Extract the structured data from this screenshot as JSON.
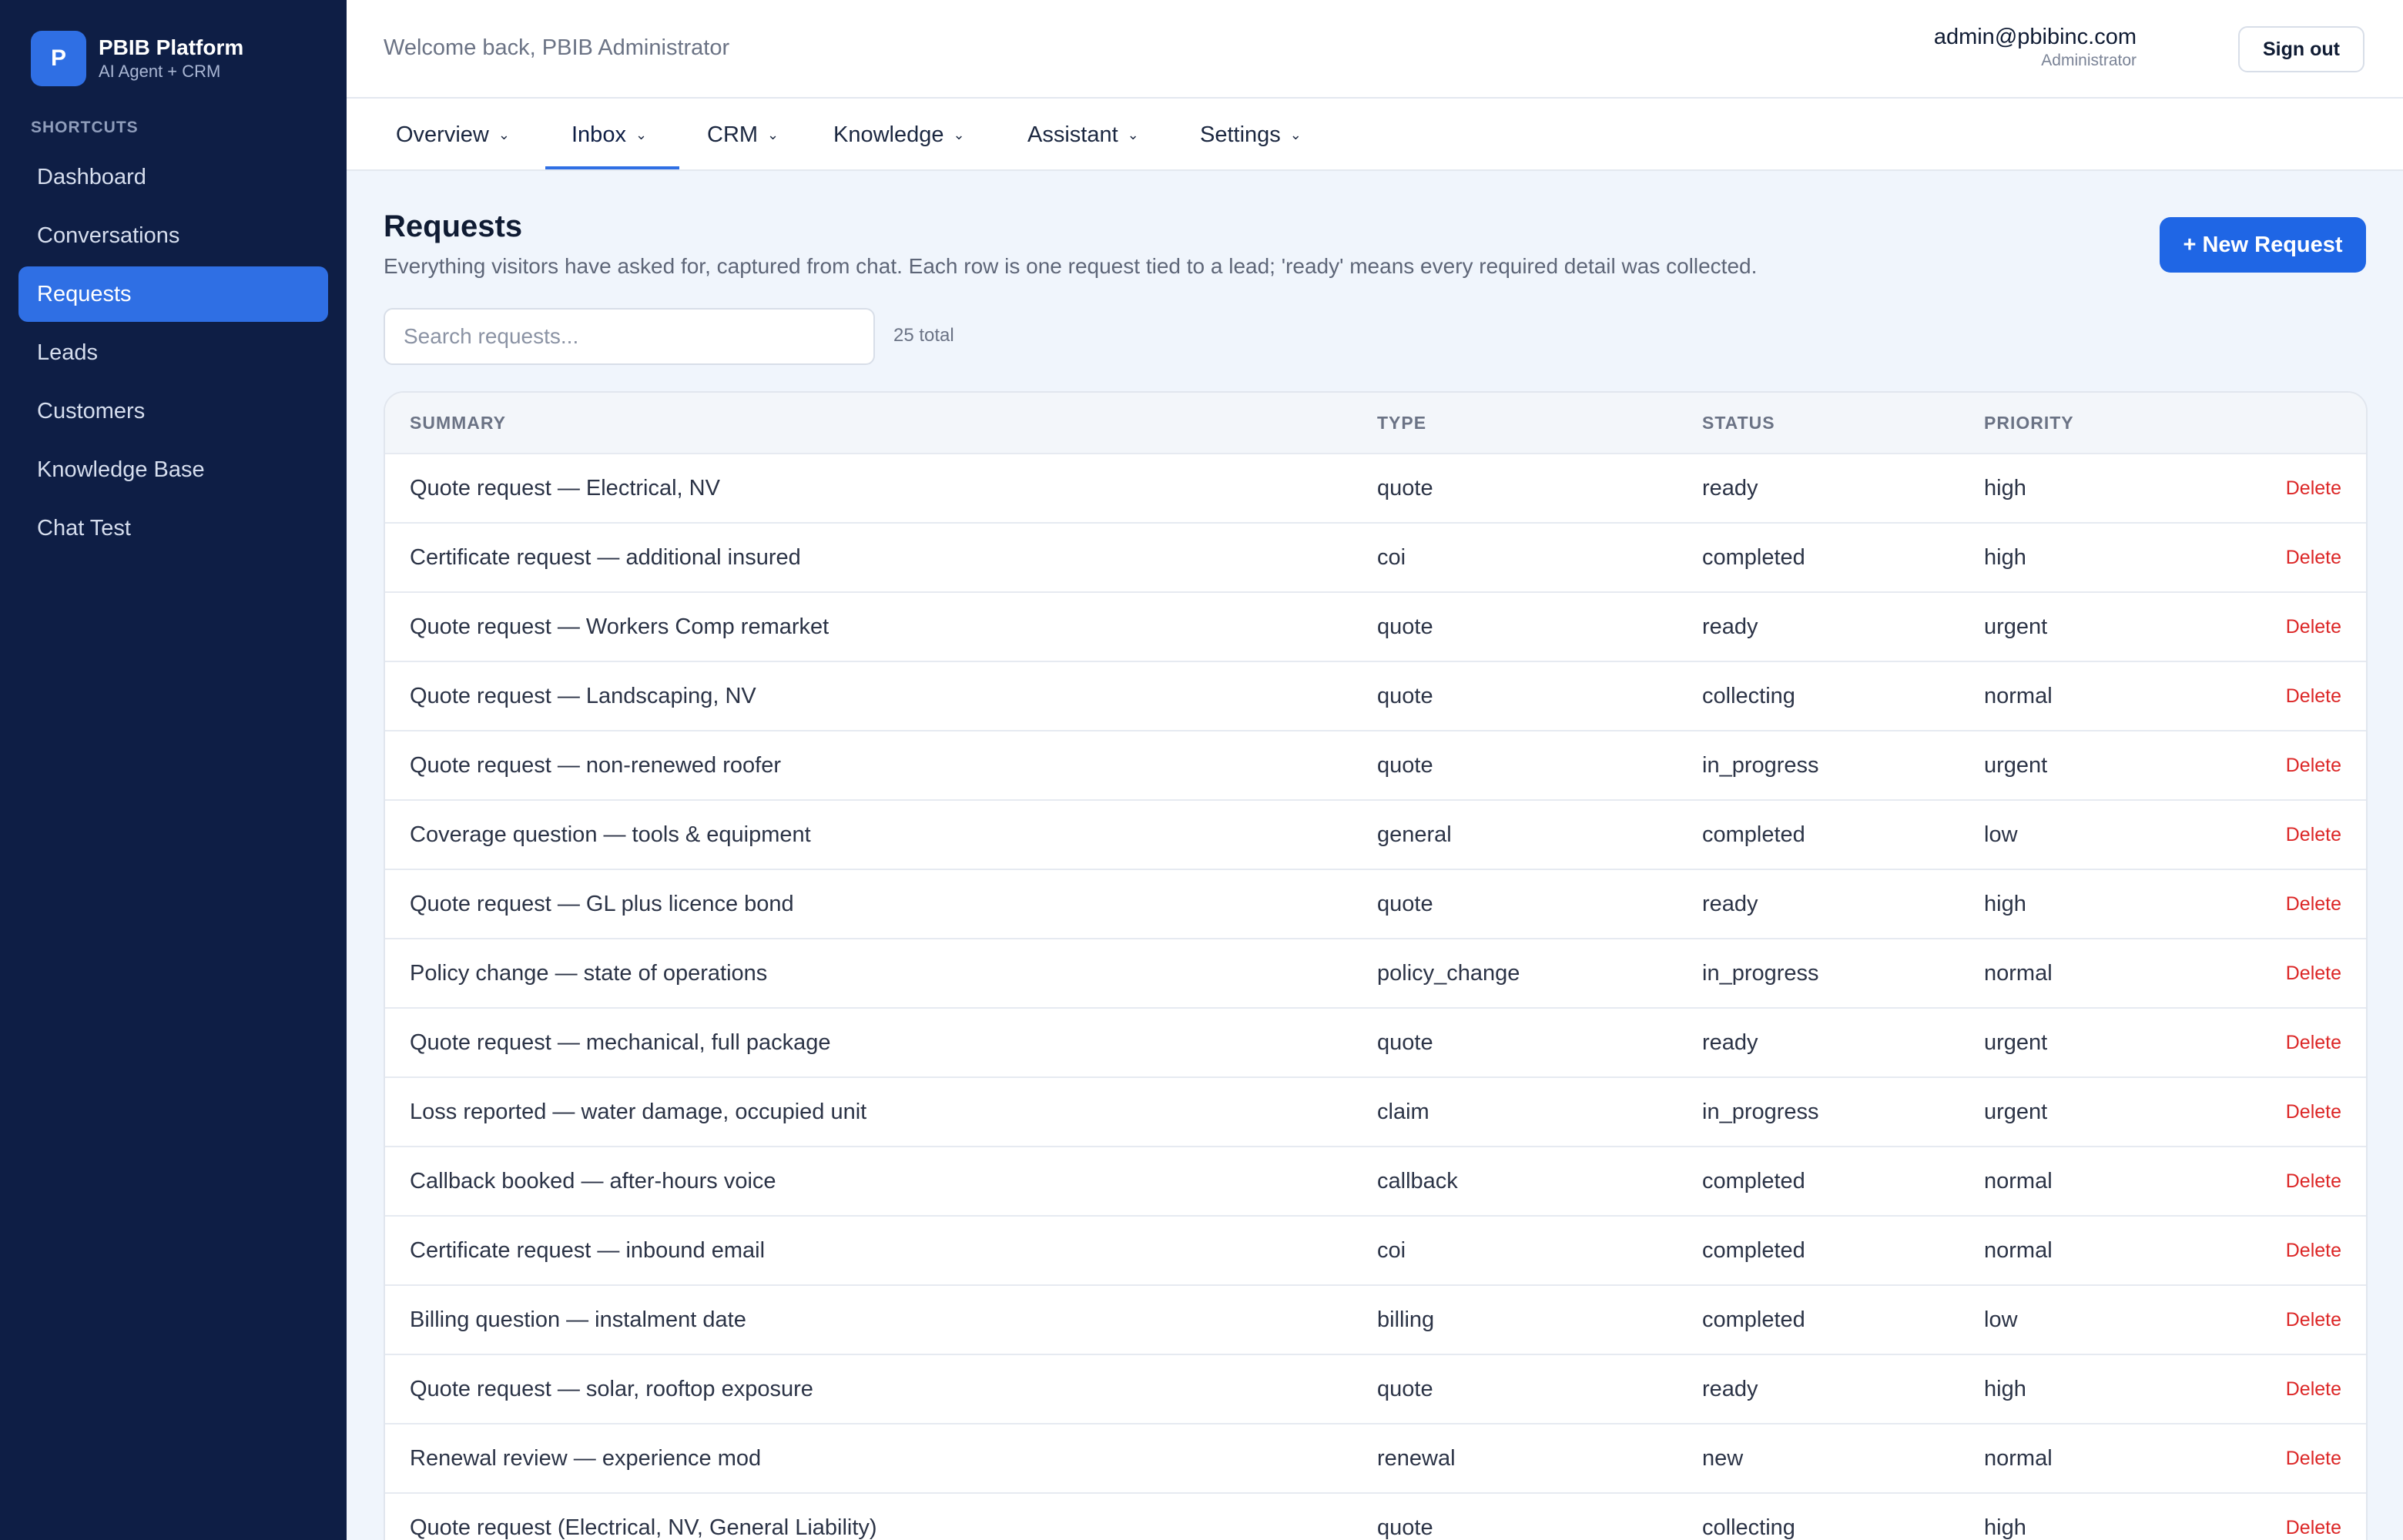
{
  "brand": {
    "logo_letter": "P",
    "title": "PBIB Platform",
    "subtitle": "AI Agent + CRM"
  },
  "sidebar": {
    "section_label": "SHORTCUTS",
    "items": [
      {
        "label": "Dashboard"
      },
      {
        "label": "Conversations"
      },
      {
        "label": "Requests",
        "active": true
      },
      {
        "label": "Leads"
      },
      {
        "label": "Customers"
      },
      {
        "label": "Knowledge Base"
      },
      {
        "label": "Chat Test"
      }
    ]
  },
  "header": {
    "welcome": "Welcome back, PBIB Administrator",
    "user_email": "admin@pbibinc.com",
    "user_role": "Administrator",
    "signout_label": "Sign out"
  },
  "tabs": [
    {
      "label": "Overview"
    },
    {
      "label": "Inbox",
      "active": true
    },
    {
      "label": "CRM"
    },
    {
      "label": "Knowledge"
    },
    {
      "label": "Assistant"
    },
    {
      "label": "Settings"
    }
  ],
  "page": {
    "title": "Requests",
    "description": "Everything visitors have asked for, captured from chat. Each row is one request tied to a lead; 'ready' means every required detail was collected.",
    "new_button": "+ New Request",
    "search_placeholder": "Search requests...",
    "total": "25 total"
  },
  "table": {
    "headers": {
      "summary": "SUMMARY",
      "type": "TYPE",
      "status": "STATUS",
      "priority": "PRIORITY"
    },
    "delete_label": "Delete",
    "rows": [
      {
        "summary": "Quote request — Electrical, NV",
        "type": "quote",
        "status": "ready",
        "priority": "high"
      },
      {
        "summary": "Certificate request — additional insured",
        "type": "coi",
        "status": "completed",
        "priority": "high"
      },
      {
        "summary": "Quote request — Workers Comp remarket",
        "type": "quote",
        "status": "ready",
        "priority": "urgent"
      },
      {
        "summary": "Quote request — Landscaping, NV",
        "type": "quote",
        "status": "collecting",
        "priority": "normal"
      },
      {
        "summary": "Quote request — non-renewed roofer",
        "type": "quote",
        "status": "in_progress",
        "priority": "urgent"
      },
      {
        "summary": "Coverage question — tools & equipment",
        "type": "general",
        "status": "completed",
        "priority": "low"
      },
      {
        "summary": "Quote request — GL plus licence bond",
        "type": "quote",
        "status": "ready",
        "priority": "high"
      },
      {
        "summary": "Policy change — state of operations",
        "type": "policy_change",
        "status": "in_progress",
        "priority": "normal"
      },
      {
        "summary": "Quote request — mechanical, full package",
        "type": "quote",
        "status": "ready",
        "priority": "urgent"
      },
      {
        "summary": "Loss reported — water damage, occupied unit",
        "type": "claim",
        "status": "in_progress",
        "priority": "urgent"
      },
      {
        "summary": "Callback booked — after-hours voice",
        "type": "callback",
        "status": "completed",
        "priority": "normal"
      },
      {
        "summary": "Certificate request — inbound email",
        "type": "coi",
        "status": "completed",
        "priority": "normal"
      },
      {
        "summary": "Billing question — instalment date",
        "type": "billing",
        "status": "completed",
        "priority": "low"
      },
      {
        "summary": "Quote request — solar, rooftop exposure",
        "type": "quote",
        "status": "ready",
        "priority": "high"
      },
      {
        "summary": "Renewal review — experience mod",
        "type": "renewal",
        "status": "new",
        "priority": "normal"
      },
      {
        "summary": "Quote request (Electrical, NV, General Liability)",
        "type": "quote",
        "status": "collecting",
        "priority": "high"
      },
      {
        "summary": "",
        "type": "",
        "status": "",
        "priority": ""
      }
    ]
  }
}
